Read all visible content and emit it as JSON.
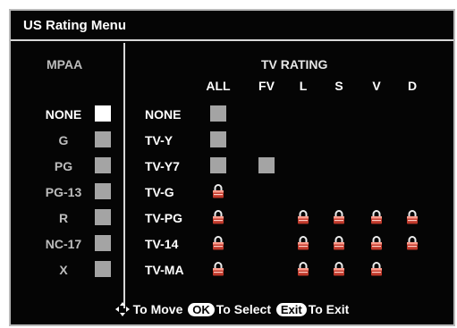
{
  "title": "US Rating Menu",
  "mpaa": {
    "header": "MPAA",
    "items": [
      {
        "label": "NONE",
        "state": "selected"
      },
      {
        "label": "G",
        "state": "off"
      },
      {
        "label": "PG",
        "state": "off"
      },
      {
        "label": "PG-13",
        "state": "off"
      },
      {
        "label": "R",
        "state": "off"
      },
      {
        "label": "NC-17",
        "state": "off"
      },
      {
        "label": "X",
        "state": "off"
      }
    ]
  },
  "tv": {
    "header": "TV RATING",
    "columns": [
      "ALL",
      "FV",
      "L",
      "S",
      "V",
      "D"
    ],
    "rows": [
      {
        "label": "NONE",
        "cells": [
          "off",
          "",
          "",
          "",
          "",
          ""
        ]
      },
      {
        "label": "TV-Y",
        "cells": [
          "off",
          "",
          "",
          "",
          "",
          ""
        ]
      },
      {
        "label": "TV-Y7",
        "cells": [
          "off",
          "off",
          "",
          "",
          "",
          ""
        ]
      },
      {
        "label": "TV-G",
        "cells": [
          "lock",
          "",
          "",
          "",
          "",
          ""
        ]
      },
      {
        "label": "TV-PG",
        "cells": [
          "lock",
          "",
          "lock",
          "lock",
          "lock",
          "lock"
        ]
      },
      {
        "label": "TV-14",
        "cells": [
          "lock",
          "",
          "lock",
          "lock",
          "lock",
          "lock"
        ]
      },
      {
        "label": "TV-MA",
        "cells": [
          "lock",
          "",
          "lock",
          "lock",
          "lock",
          ""
        ]
      }
    ]
  },
  "footer": {
    "move_text": "To Move",
    "ok_key": "OK",
    "select_text": "To Select",
    "exit_key": "Exit",
    "exit_text": "To Exit"
  },
  "icons": {
    "lock": "padlock-icon",
    "nav": "four-way-arrow-icon"
  },
  "colors": {
    "background": "#050505",
    "selected": "#ffffff",
    "unselected": "#a4a4a4",
    "lock_body": "#c0392b"
  }
}
